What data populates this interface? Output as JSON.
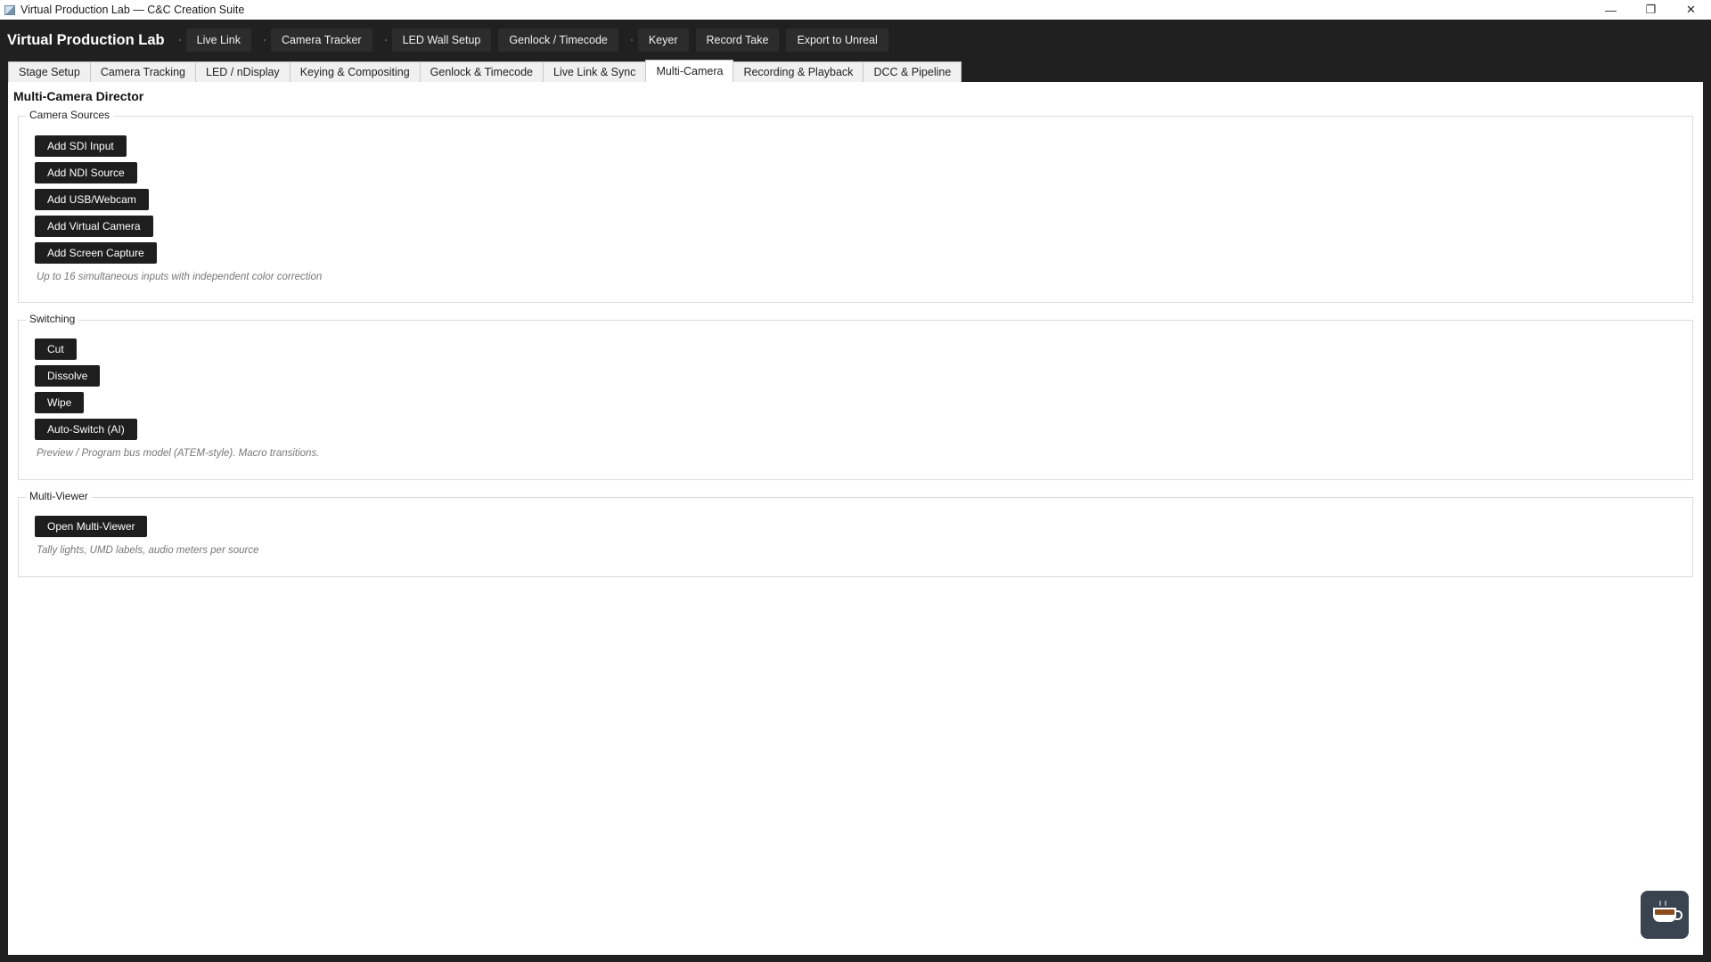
{
  "window": {
    "title": "Virtual Production Lab — C&C Creation Suite",
    "controls": [
      "—",
      "❐",
      "✕"
    ]
  },
  "toolbar": {
    "brand": "Virtual Production Lab",
    "buttons": [
      "Live Link",
      "Camera Tracker",
      "LED Wall Setup",
      "Genlock / Timecode",
      "Keyer",
      "Record Take",
      "Export to Unreal"
    ]
  },
  "tabs": [
    "Stage Setup",
    "Camera Tracking",
    "LED / nDisplay",
    "Keying & Compositing",
    "Genlock & Timecode",
    "Live Link & Sync",
    "Multi-Camera",
    "Recording & Playback",
    "DCC & Pipeline"
  ],
  "active_tab": "Multi-Camera",
  "main": {
    "title": "Multi-Camera Director",
    "camera_sources": {
      "title": "Camera Sources",
      "buttons": [
        "Add SDI Input",
        "Add NDI Source",
        "Add USB/Webcam",
        "Add Virtual Camera",
        "Add Screen Capture"
      ],
      "hint": "Up to 16 simultaneous inputs with independent color correction"
    },
    "switching": {
      "title": "Switching",
      "buttons": [
        "Cut",
        "Dissolve",
        "Wipe",
        "Auto-Switch (AI)"
      ],
      "hint": "Preview / Program bus model (ATEM-style). Macro transitions."
    },
    "multiviewer": {
      "title": "Multi-Viewer",
      "buttons": [
        "Open Multi-Viewer"
      ],
      "hint": "Tally lights, UMD labels, audio meters per source"
    }
  },
  "fab": {
    "icon": "coffee-cup-icon"
  }
}
